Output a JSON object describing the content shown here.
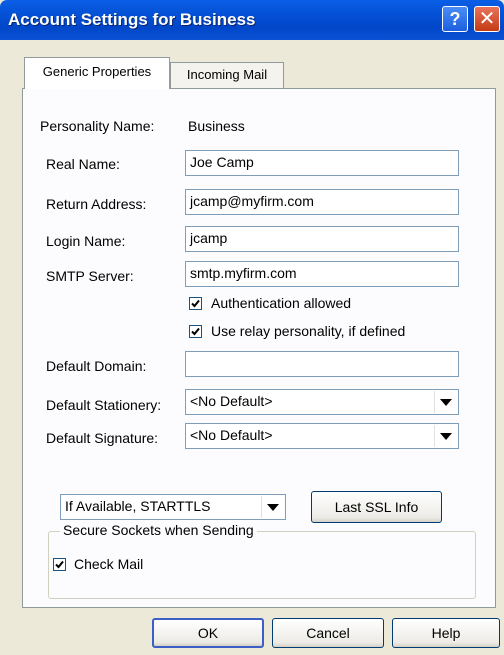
{
  "window": {
    "title": "Account Settings for Business",
    "help_glyph": "?",
    "close_glyph": "✕"
  },
  "tabs": [
    {
      "label": "Generic Properties"
    },
    {
      "label": "Incoming Mail"
    }
  ],
  "form": {
    "personality_label": "Personality Name:",
    "personality_value": "Business",
    "real_name_label": "Real Name:",
    "real_name_value": "Joe Camp",
    "return_address_label": "Return Address:",
    "return_address_value": "jcamp@myfirm.com",
    "login_name_label": "Login Name:",
    "login_name_value": "jcamp",
    "smtp_label": "SMTP Server:",
    "smtp_value": "smtp.myfirm.com",
    "auth_label": "Authentication allowed",
    "relay_label": "Use relay personality, if defined",
    "default_domain_label": "Default Domain:",
    "default_domain_value": "",
    "stationery_label": "Default Stationery:",
    "stationery_value": "<No Default>",
    "signature_label": "Default Signature:",
    "signature_value": "<No Default>"
  },
  "ssl_group": {
    "title": "Secure Sockets when Sending",
    "select_value": "If Available, STARTTLS",
    "info_button": "Last SSL Info"
  },
  "check_mail_label": "Check Mail",
  "buttons": {
    "ok": "OK",
    "cancel": "Cancel",
    "help": "Help"
  },
  "checkboxes": {
    "auth_checked": true,
    "relay_checked": true,
    "check_mail_checked": true
  }
}
